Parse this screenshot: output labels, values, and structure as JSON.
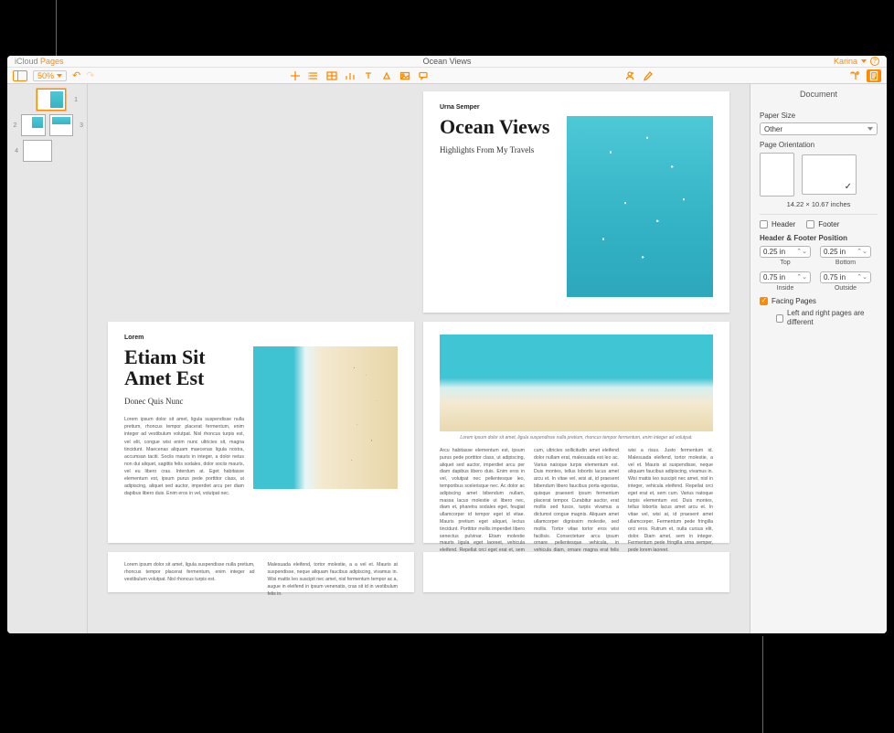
{
  "brand": {
    "prefix": "iCloud",
    "suffix": "Pages"
  },
  "document_title": "Ocean Views",
  "user_name": "Karina",
  "zoom": "50%",
  "thumbnails": {
    "spreads": [
      {
        "pages": [
          1
        ],
        "selected": true
      },
      {
        "pages": [
          2,
          3
        ]
      },
      {
        "pages": [
          4
        ]
      }
    ]
  },
  "page1": {
    "author": "Urna Semper",
    "title": "Ocean Views",
    "subtitle": "Highlights From My Travels"
  },
  "page2": {
    "kicker": "Lorem",
    "title": "Etiam Sit Amet Est",
    "sub": "Donec Quis Nunc",
    "body1": "Lorem ipsum dolor sit amet, ligula suspendisse nulla pretium, rhoncus tempor placerat fermentum, enim integer ad vestibulum volutpat. Nisl rhoncus turpis est, vel elit, congue wisi enim nunc ultricies sit, magna tincidunt. Maecenas aliquam maecenas ligula nostra, accumsan taciti. Sociis mauris in integer, a dolor netus non dui aliquet, sagittis felis sodales, dolor sociis mauris, vel eu libero cras. Interdum at. Eget habitasse elementum est, ipsum purus pede porttitor class, ut adipiscing, aliquet sed auctor, imperdiet arcu per diam dapibus libero duis. Enim eros in vel, volutpat nec.",
    "body2": "Lorem ipsum dolor sit amet, ligula suspendisse nulla pretium, rhoncus tempor placerat fermentum, enim integer ad vestibulum volutpat. Nisl rhoncus turpis est, vel elit, congue wisi enim nunc ultricies sit, magna tincidunt."
  },
  "page3": {
    "caption": "Lorem ipsum dolor sit amet, ligula suspendisse nulla pretium, rhoncus tempor fermentum, enim integer ad volutpat.",
    "body": "Arcu habitasse elementum est, ipsum purus pede porttitor class, ut adipiscing, aliquet sed auctor, imperdiet arcu per diam dapibus libero duis. Enim eros in vel, volutpat nec pellentesque leo, temporibus scelerisque nec. Ac dolor ac adipiscing amet bibendum nullam, massa lacus molestie ut libero nec, diam et, pharetra sodales eget, feugiat ullamcorper id tempor eget id vitae. Mauris pretium eget aliquet, lectus tincidunt. Porttitor mollis imperdiet libero senectus pulvinar. Etiam molestie mauris ligula eget laoreet, vehicula eleifend. Repellat orci eget erat et, sem cum, ultricies sollicitudin amet eleifend dolor nullam erat, malesuada est leo ac. Varius natoque turpis elementum est. Duis montes, tellus lobortis lacus amet arcu et. In vitae vel, wisi at, id praesent bibendum libero faucibus porta egestas, quisque praesent ipsum fermentum placerat tempor. Curabitur auctor, erat mollis sed fusce, turpis vivamus a dictumst congue magnis. Aliquam amet ullamcorper dignissim molestie, sed mollis. Tortor vitae tortor eros wisi facilisis. Consectetuer arcu ipsum ornare pellentesque vehicula, in vehicula diam, ornare magna erat felis wisi a risus. Justo fermentum id. Malesuada eleifend, tortor molestie, a vel et. Mauris at suspendisse, neque aliquam faucibus adipiscing, vivamus in. Wisi mattis leo suscipit nec amet, nisl in integer, vehicula eleifend. Repellat orci eget erat et, sem cum. Varius natoque turpis elementum est. Duis montes, tellus lobortis lacus amet arcu et. In vitae vel, wisi at, id praesent amet ullamcorper. Fermentum pede fringilla orci eros. Rutrum et, nulla cursus elit, dolor. Diam amet, sem in integer. Fermentum pede fringilla urna semper, pede lorem laoreet."
  },
  "page4": {
    "col1": "Lorem ipsum dolor sit amet, ligula suspendisse nulla pretium, rhoncus tempor placerat fermentum, enim integer ad vestibulum volutpat. Nisl rhoncus turpis est.",
    "col2": "Malesuada eleifend, tortor molestie, a a vel et. Mauris at suspendisse, neque aliquam faucibus adipiscing, vivamus in. Wisi mattis leo suscipit nec amet, nisl fermentum tempor ac a, augue in eleifend in ipsum venenatis, cras sit id in vestibulum felis in."
  },
  "inspector": {
    "title": "Document",
    "paper_size_label": "Paper Size",
    "paper_size_value": "Other",
    "orientation_label": "Page Orientation",
    "dimensions": "14.22 × 10.67 inches",
    "header_label": "Header",
    "footer_label": "Footer",
    "hfpos_label": "Header & Footer Position",
    "top_val": "0.25 in",
    "top_lbl": "Top",
    "bottom_val": "0.25 in",
    "bottom_lbl": "Bottom",
    "inside_val": "0.75 in",
    "inside_lbl": "Inside",
    "outside_val": "0.75 in",
    "outside_lbl": "Outside",
    "facing_pages": "Facing Pages",
    "lr_different": "Left and right pages are different"
  }
}
